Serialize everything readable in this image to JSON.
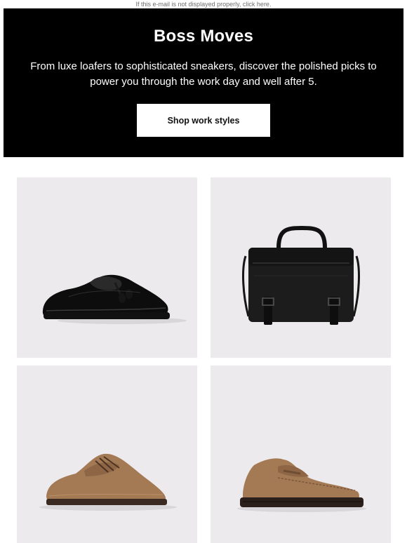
{
  "preheader": {
    "text": "If this e-mail is not displayed properly, click here."
  },
  "hero": {
    "title": "Boss Moves",
    "body": "From luxe loafers to sophisticated sneakers, discover the polished picks to power you through the work day and well after 5.",
    "cta_label": "Shop work styles"
  },
  "products": [
    {
      "icon": "black-tassel-loafer-image"
    },
    {
      "icon": "black-messenger-bag-image"
    },
    {
      "icon": "tan-suede-derby-shoe-image"
    },
    {
      "icon": "tan-suede-penny-loafer-image"
    }
  ],
  "colors": {
    "hero_bg": "#000000",
    "hero_text": "#ffffff",
    "tile_bg": "#eceaed",
    "suede": "#a47a55",
    "sole": "#3b2a22"
  }
}
